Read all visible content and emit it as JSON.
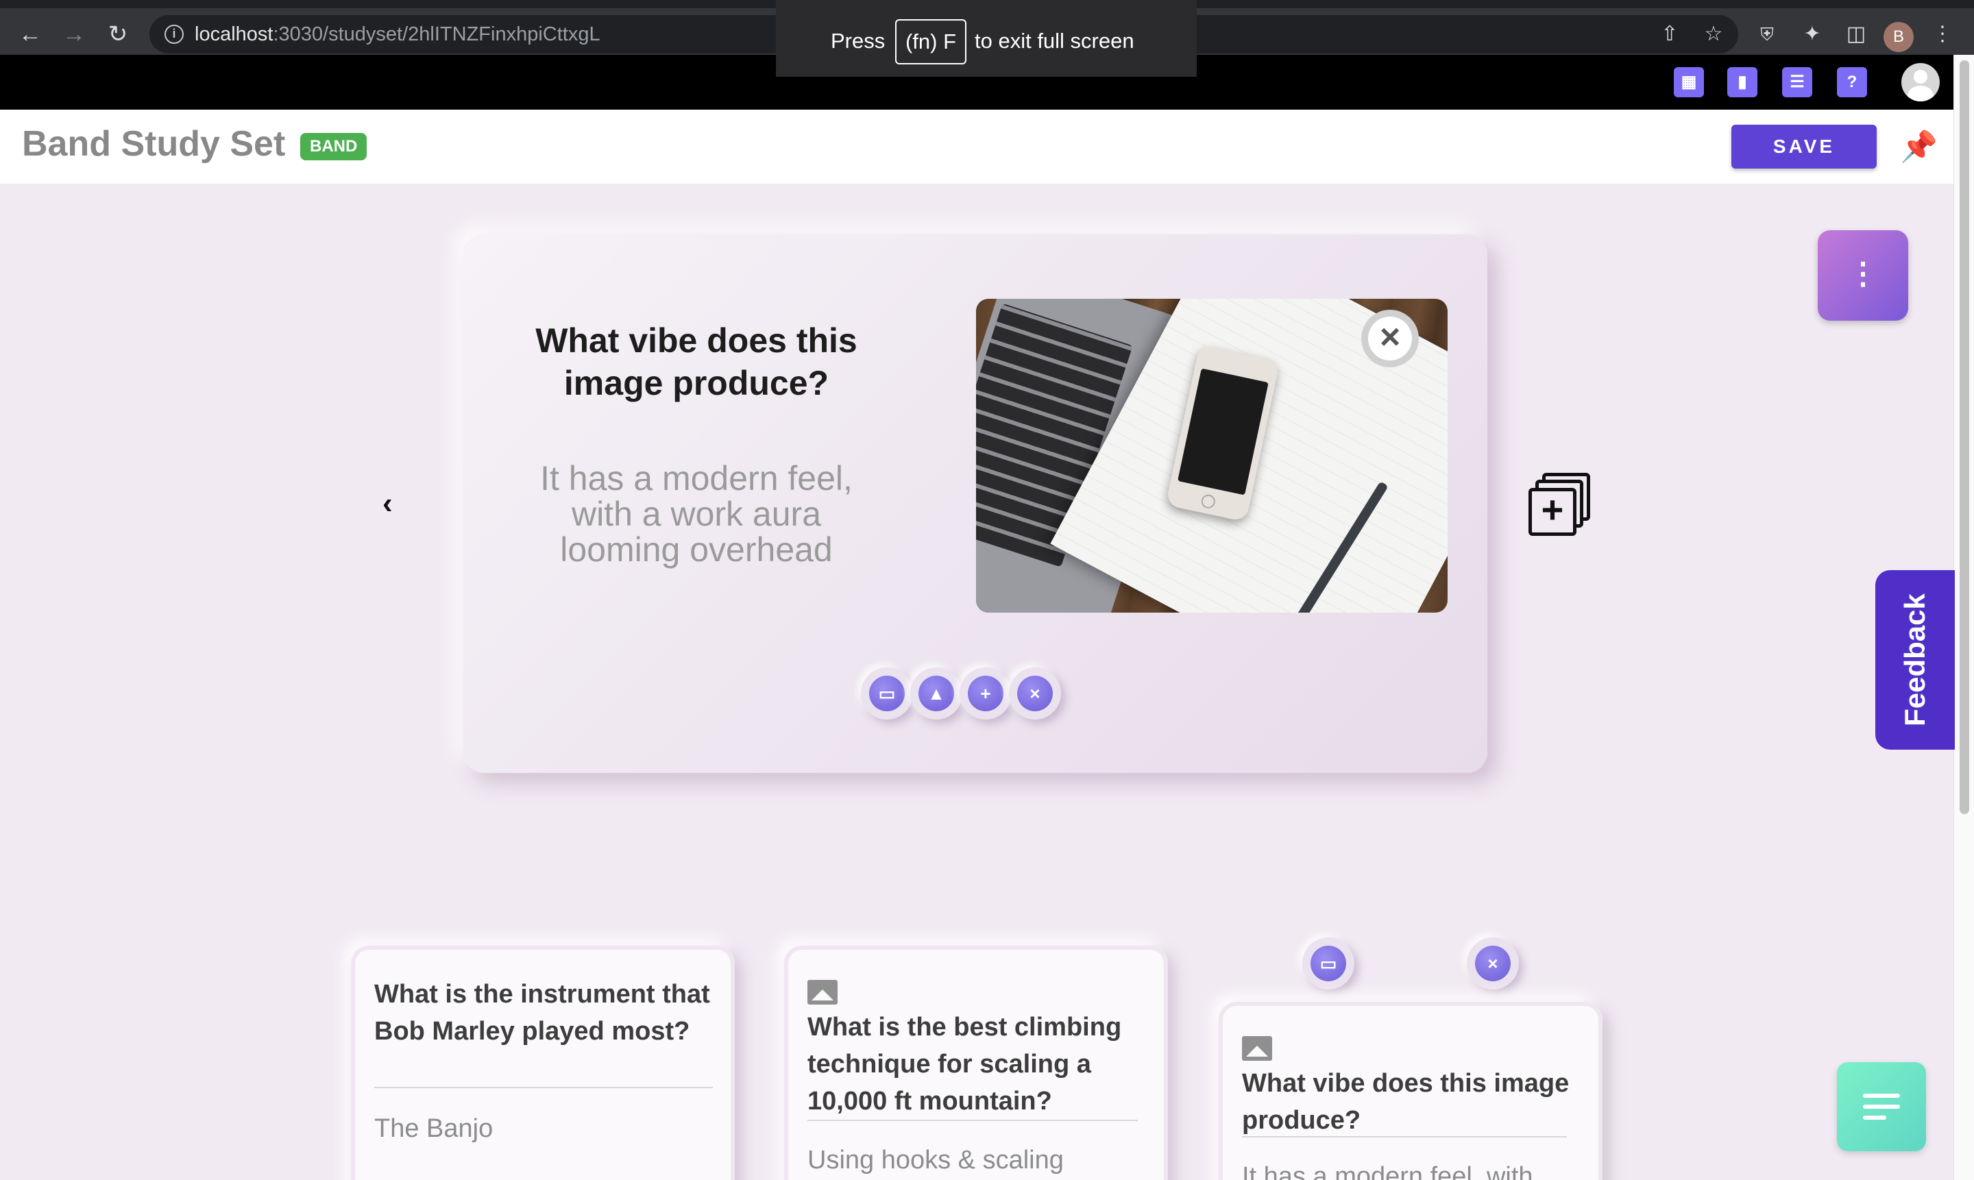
{
  "browser": {
    "url_host": "localhost",
    "url_path": ":3030/studyset/2hlITNZFinxhpiCttxgL",
    "profile_initial": "B",
    "fullscreen_press": "Press",
    "fullscreen_key": "(fn) F",
    "fullscreen_exit": "to exit full screen"
  },
  "header": {
    "title": "Band Study Set",
    "badge": "BAND",
    "save_label": "SAVE"
  },
  "current_card": {
    "question": "What vibe does this image produce?",
    "answer": "It has a modern feel, with a work aura looming overhead"
  },
  "feedback_label": "Feedback",
  "cards": [
    {
      "question": "What is the instrument that Bob Marley played most?",
      "answer": "The Banjo"
    },
    {
      "question": "What is the best climbing technique for scaling a 10,000 ft mountain?",
      "answer": "Using hooks & scaling"
    },
    {
      "question": "What vibe does this image produce?",
      "answer": "It has a modern feel, with"
    }
  ],
  "colors": {
    "accent": "#5e42d6",
    "badge": "#4caf50",
    "feedback": "#4f2fc8",
    "background": "#f1eaf2"
  }
}
